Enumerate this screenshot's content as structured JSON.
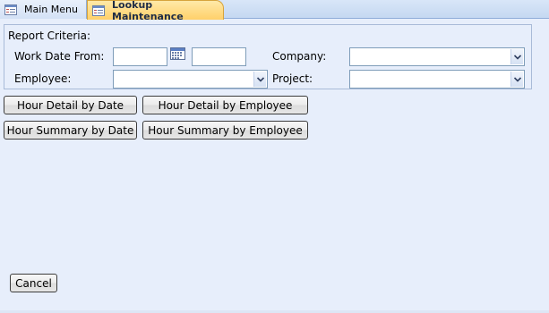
{
  "tabs": [
    {
      "label": "Main Menu",
      "active": false
    },
    {
      "label": "Lookup Maintenance",
      "active": true
    }
  ],
  "criteria": {
    "title": "Report Criteria:",
    "work_date_from_label": "Work Date From:",
    "work_date_from_value": "",
    "work_date_to_value": "",
    "company_label": "Company:",
    "company_value": "",
    "employee_label": "Employee:",
    "employee_value": "",
    "project_label": "Project:",
    "project_value": ""
  },
  "buttons": {
    "hour_detail_by_date": "Hour Detail by Date",
    "hour_detail_by_employee": "Hour Detail by Employee",
    "hour_summary_by_date": "Hour Summary by Date",
    "hour_summary_by_employee": "Hour Summary by Employee",
    "cancel": "Cancel"
  },
  "colors": {
    "active_tab": "#ffd06a",
    "form_background": "#e7eefb",
    "border": "#7f9db9"
  },
  "icons": {
    "tab_icon": "form-icon",
    "calendar": "calendar-icon",
    "dropdown": "chevron-down-icon"
  }
}
